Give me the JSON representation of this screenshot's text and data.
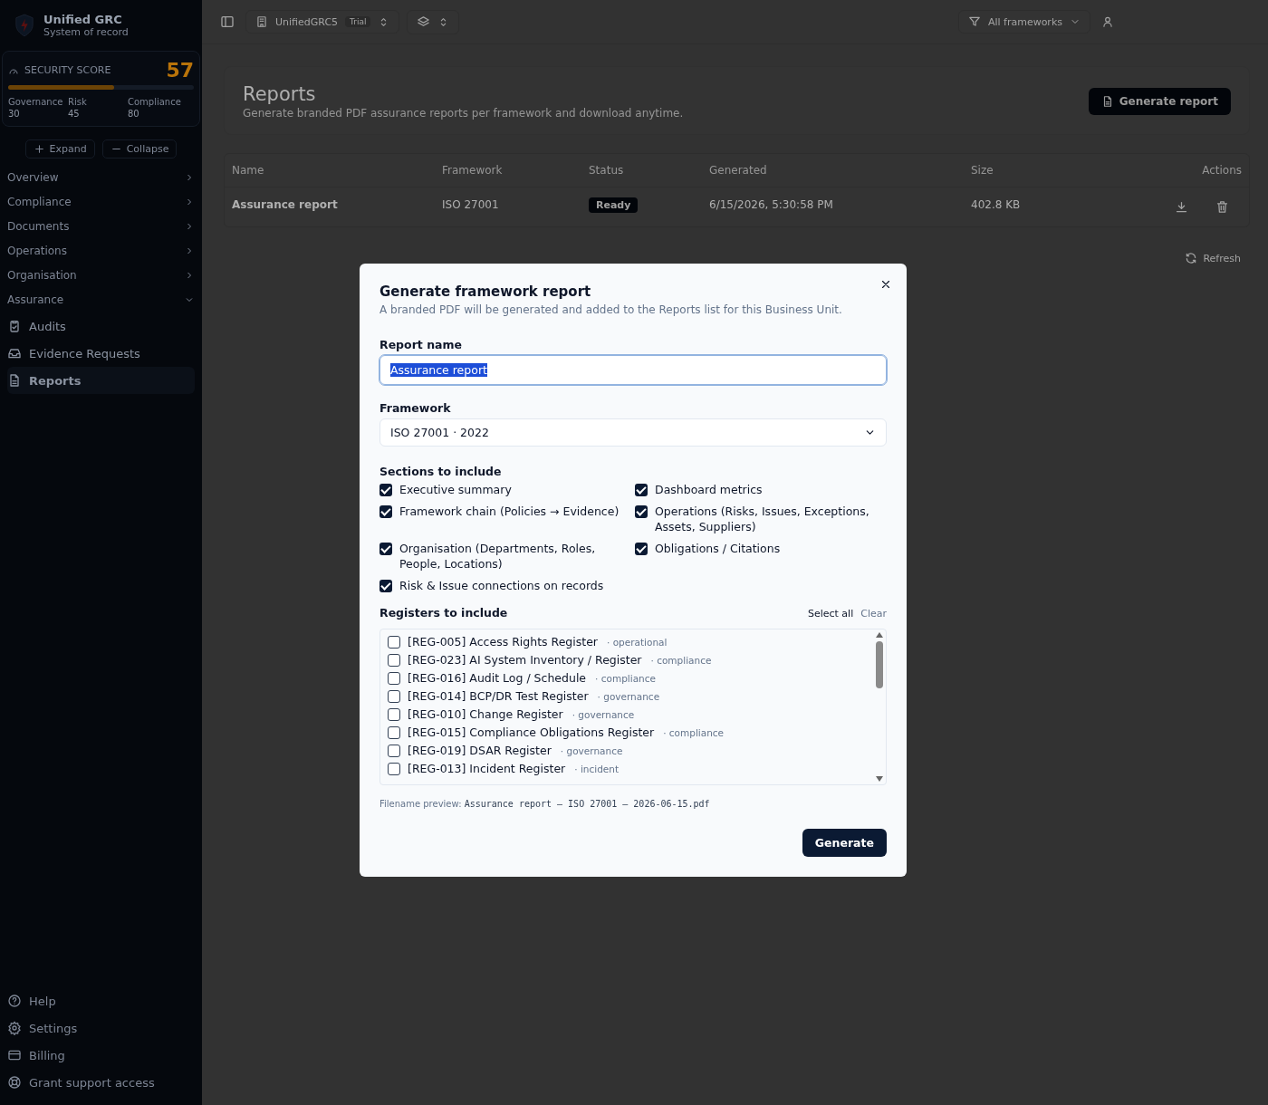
{
  "brand": {
    "title": "Unified GRC",
    "subtitle": "System of record"
  },
  "security_score": {
    "label": "SECURITY SCORE",
    "value": "57",
    "level": 0.57,
    "metrics": [
      {
        "label": "Governance",
        "value": "30"
      },
      {
        "label": "Risk",
        "value": "45"
      },
      {
        "label": "Compliance",
        "value": "80"
      }
    ]
  },
  "tree_buttons": [
    {
      "label": "Expand"
    },
    {
      "label": "Collapse"
    }
  ],
  "nav": [
    {
      "label": "Overview",
      "expanded": false
    },
    {
      "label": "Compliance",
      "expanded": false
    },
    {
      "label": "Documents",
      "expanded": false
    },
    {
      "label": "Operations",
      "expanded": false
    },
    {
      "label": "Organisation",
      "expanded": false
    },
    {
      "label": "Assurance",
      "expanded": true,
      "children": [
        {
          "label": "Audits",
          "selected": false
        },
        {
          "label": "Evidence Requests",
          "selected": false
        },
        {
          "label": "Reports",
          "selected": true
        }
      ]
    }
  ],
  "sidebar_footer": [
    {
      "label": "Help"
    },
    {
      "label": "Settings"
    },
    {
      "label": "Billing"
    },
    {
      "label": "Grant support access"
    }
  ],
  "topbar": {
    "workspace": "UnifiedGRC5",
    "plan": "Trial",
    "filter": "All frameworks"
  },
  "page": {
    "title": "Reports",
    "subtitle": "Generate branded PDF assurance reports per framework and download anytime.",
    "action": "Generate report"
  },
  "table": {
    "columns": [
      "Name",
      "Framework",
      "Status",
      "Generated",
      "Size",
      "Actions"
    ],
    "rows": [
      {
        "name": "Assurance report",
        "framework": "ISO 27001",
        "status": "Ready",
        "generated": "6/15/2026, 5:30:58 PM",
        "size": "402.8 KB"
      }
    ]
  },
  "refresh": "Refresh",
  "dialog": {
    "title": "Generate framework report",
    "description": "A branded PDF will be generated and added to the Reports list for this Business Unit.",
    "name_label": "Report name",
    "name_value": "Assurance report",
    "framework_label": "Framework",
    "framework_value": "ISO 27001 · 2022",
    "sections_label": "Sections to include",
    "sections": [
      {
        "label": "Executive summary",
        "checked": true
      },
      {
        "label": "Dashboard metrics",
        "checked": true
      },
      {
        "label": "Framework chain (Policies → Evidence)",
        "checked": true
      },
      {
        "label": "Operations (Risks, Issues, Exceptions, Assets, Suppliers)",
        "checked": true
      },
      {
        "label": "Organisation (Departments, Roles, People, Locations)",
        "checked": true
      },
      {
        "label": "Obligations / Citations",
        "checked": true
      },
      {
        "label": "Risk & Issue connections on records",
        "checked": true
      }
    ],
    "registers_label": "Registers to include",
    "select_all": "Select all",
    "clear": "Clear",
    "registers": [
      {
        "label": "[REG-005] Access Rights Register",
        "category": "· operational",
        "checked": false
      },
      {
        "label": "[REG-023] AI System Inventory / Register",
        "category": "· compliance",
        "checked": false
      },
      {
        "label": "[REG-016] Audit Log / Schedule",
        "category": "· compliance",
        "checked": false
      },
      {
        "label": "[REG-014] BCP/DR Test Register",
        "category": "· governance",
        "checked": false
      },
      {
        "label": "[REG-010] Change Register",
        "category": "· governance",
        "checked": false
      },
      {
        "label": "[REG-015] Compliance Obligations Register",
        "category": "· compliance",
        "checked": false
      },
      {
        "label": "[REG-019] DSAR Register",
        "category": "· governance",
        "checked": false
      },
      {
        "label": "[REG-013] Incident Register",
        "category": "· incident",
        "checked": false
      }
    ],
    "filename_label": "Filename preview:",
    "filename": "Assurance report — ISO 27001 — 2026-06-15.pdf",
    "submit": "Generate"
  }
}
